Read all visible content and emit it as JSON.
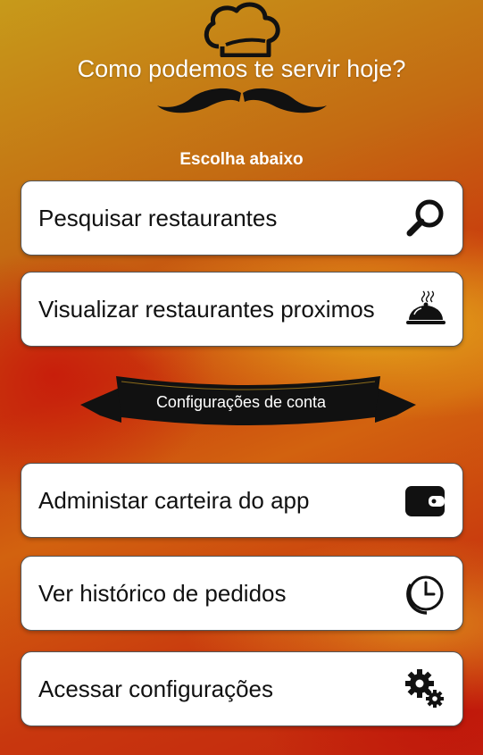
{
  "header": {
    "headline": "Como podemos te servir hoje?",
    "logo_icon": "chef-hat-mustache-icon"
  },
  "menu": {
    "subtitle": "Escolha abaixo",
    "items": [
      {
        "label": "Pesquisar restaurantes",
        "icon": "magnifier-icon"
      },
      {
        "label": "Visualizar restaurantes proximos",
        "icon": "food-cloche-icon"
      }
    ]
  },
  "account": {
    "banner_label": "Configurações de conta",
    "items": [
      {
        "label": "Administar carteira do app",
        "icon": "wallet-icon"
      },
      {
        "label": "Ver histórico de pedidos",
        "icon": "history-clock-icon"
      },
      {
        "label": "Acessar configurações",
        "icon": "gears-icon"
      }
    ]
  },
  "colors": {
    "card_background": "#ffffff",
    "text": "#111111",
    "ribbon": "#111111",
    "background_orange": "#c9400e",
    "background_gold": "#d9a81e"
  }
}
